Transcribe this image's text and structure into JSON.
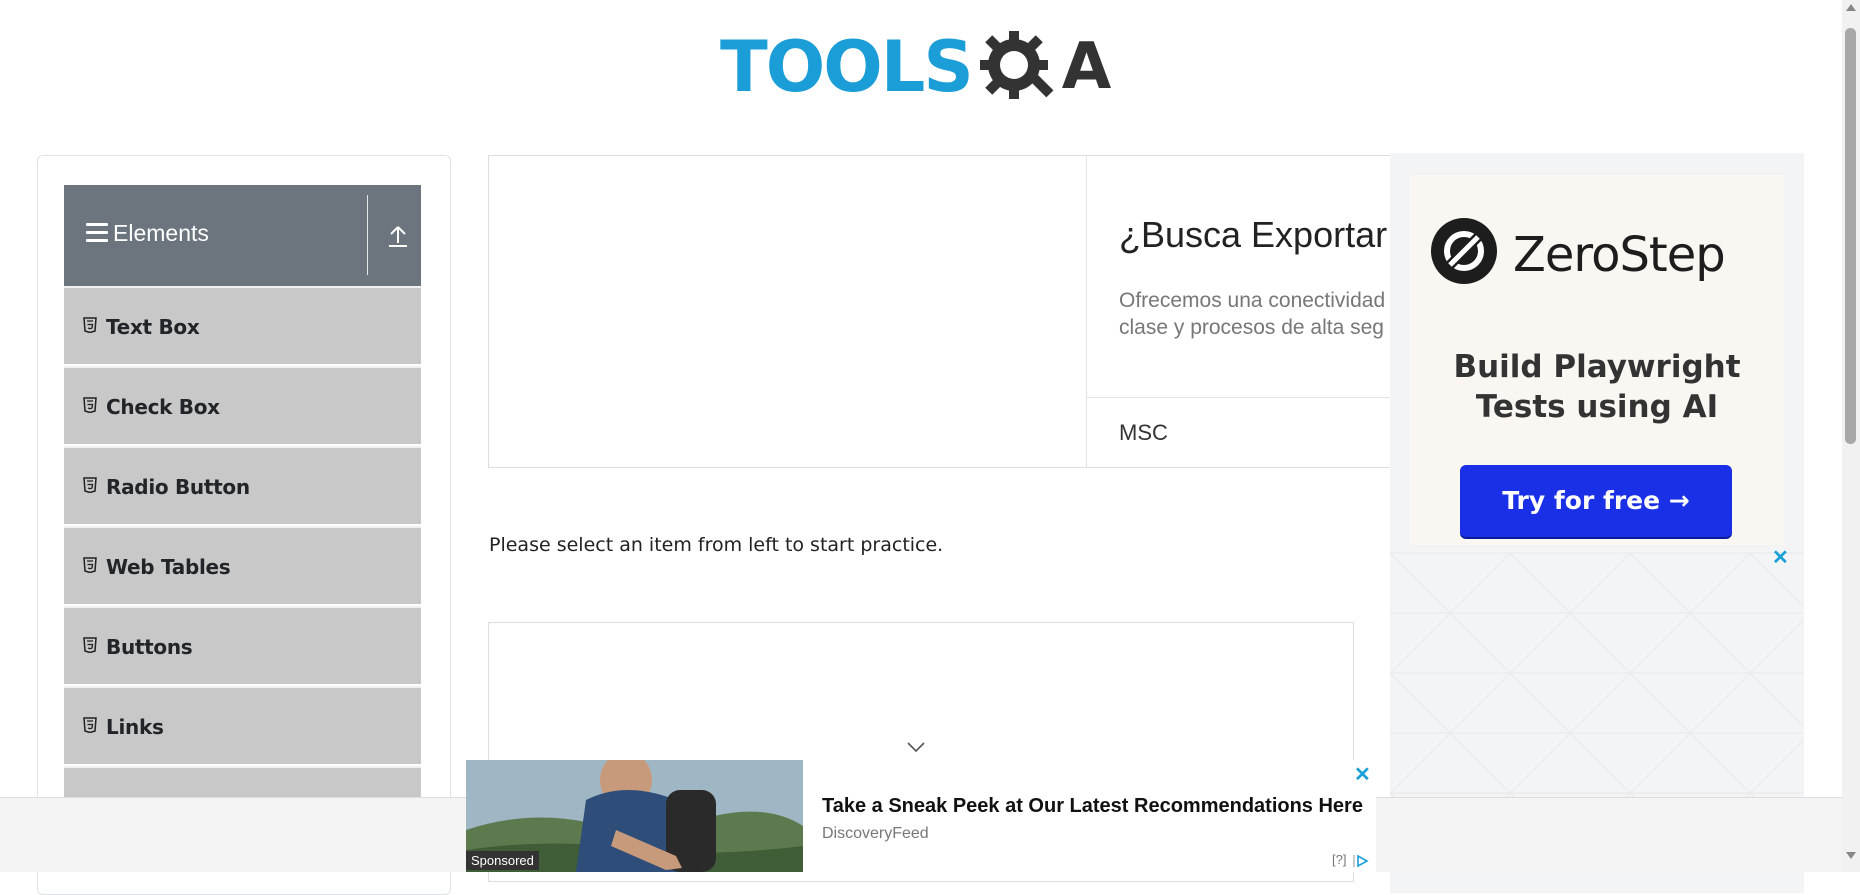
{
  "logo": {
    "tools": "TOOLS",
    "qa_a": "A",
    "icon": "gear-magnifier-icon"
  },
  "sidebar": {
    "group_title": "Elements",
    "group_icon": "hamburger-icon",
    "toggle_icon": "upload-arrow-icon",
    "items": [
      {
        "label": "Text Box",
        "icon": "html5-icon"
      },
      {
        "label": "Check Box",
        "icon": "html5-icon"
      },
      {
        "label": "Radio Button",
        "icon": "html5-icon"
      },
      {
        "label": "Web Tables",
        "icon": "html5-icon"
      },
      {
        "label": "Buttons",
        "icon": "html5-icon"
      },
      {
        "label": "Links",
        "icon": "html5-icon"
      }
    ]
  },
  "top_ad": {
    "title": "¿Busca Exportar",
    "description": "Ofrecemos una conectividad clase y procesos de alta seg",
    "brand": "MSC"
  },
  "main": {
    "instructions": "Please select an item from left to start practice."
  },
  "right_ad": {
    "brand": "ZeroStep",
    "tagline": "Build Playwright Tests using AI",
    "cta": "Try for free →",
    "close": "✕",
    "colors": {
      "cta": "#1a30e6",
      "panel": "#faf7f3"
    }
  },
  "bottom_ad": {
    "sponsored": "Sponsored",
    "headline": "Take a Sneak Peek at Our Latest Recommendations Here",
    "source": "DiscoveryFeed",
    "close": "✕",
    "adchoice": "[?]"
  },
  "colors": {
    "brand_blue": "#1b9dd8",
    "sidebar_header": "#6c757d",
    "menu_item": "#c8c8c8"
  }
}
